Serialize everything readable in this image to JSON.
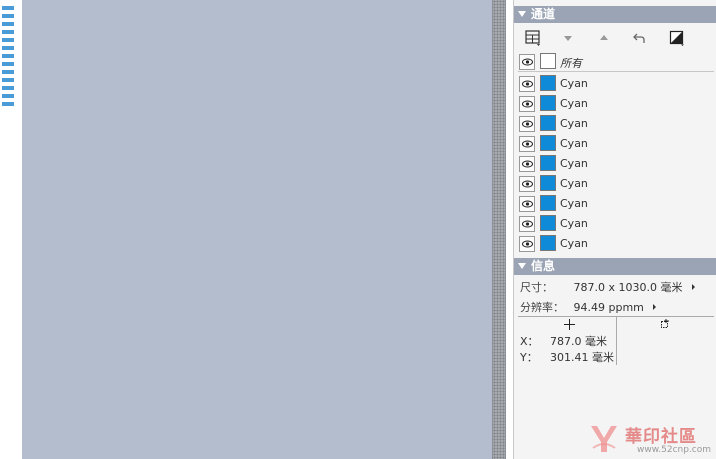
{
  "channels_panel": {
    "title": "通道",
    "toolbar": [
      {
        "name": "channel-grid-icon",
        "glyph": "⊞"
      },
      {
        "name": "move-down-icon",
        "glyph": "▾"
      },
      {
        "name": "move-up-icon",
        "glyph": "▴"
      },
      {
        "name": "undo-icon",
        "glyph": "↶"
      },
      {
        "name": "invert-icon",
        "glyph": "◪"
      }
    ],
    "all_label": "所有",
    "channels": [
      {
        "label": "Cyan",
        "color": "#0e8ad8"
      },
      {
        "label": "Cyan",
        "color": "#0e8ad8"
      },
      {
        "label": "Cyan",
        "color": "#0e8ad8"
      },
      {
        "label": "Cyan",
        "color": "#0e8ad8"
      },
      {
        "label": "Cyan",
        "color": "#0e8ad8"
      },
      {
        "label": "Cyan",
        "color": "#0e8ad8"
      },
      {
        "label": "Cyan",
        "color": "#0e8ad8"
      },
      {
        "label": "Cyan",
        "color": "#0e8ad8"
      },
      {
        "label": "Cyan",
        "color": "#0e8ad8"
      }
    ]
  },
  "info_panel": {
    "title": "信息",
    "size_label": "尺寸：",
    "size_value": "787.0 x 1030.0 毫米",
    "resolution_label": "分辨率：",
    "resolution_value": "94.49 ppmm",
    "x_label": "X：",
    "x_value": "787.0 毫米",
    "y_label": "Y：",
    "y_value": "301.41 毫米"
  },
  "watermark": {
    "title": "華印社區",
    "url": "www.52cnp.com"
  },
  "colors": {
    "canvas": "#b4bdcd",
    "panel_header": "#9ba4b4",
    "cyan_swatch": "#0e8ad8"
  }
}
